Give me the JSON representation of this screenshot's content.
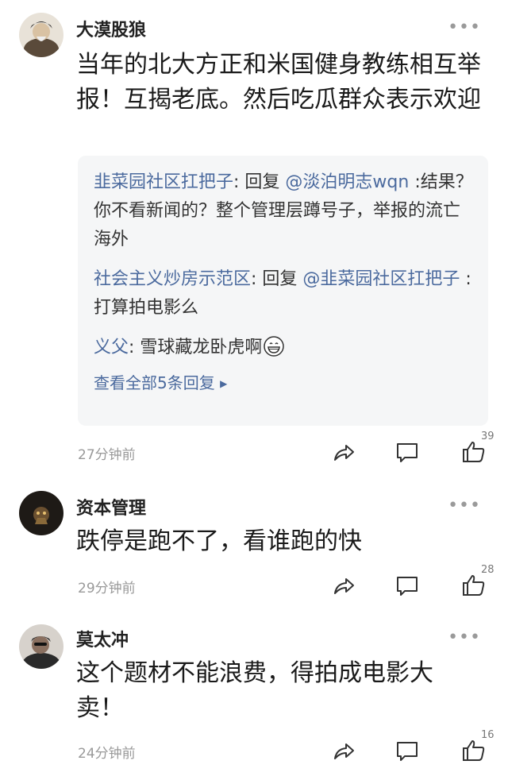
{
  "comments": [
    {
      "username": "大漠股狼",
      "more": "•••",
      "content": "当年的北大方正和米国健身教练相互举报！互揭老底。然后吃瓜群众表示欢迎",
      "replies": [
        {
          "name": "韭菜园社区扛把子",
          "sep": ": 回复 ",
          "at": "@淡泊明志wqn",
          "text": " :结果？你不看新闻的？整个管理层蹲号子，举报的流亡海外"
        },
        {
          "name": "社会主义炒房示范区",
          "sep": ": 回复 ",
          "at": "@韭菜园社区扛把子",
          "text": " :打算拍电影么"
        },
        {
          "name": "义父",
          "sep": ": ",
          "at": "",
          "text": "雪球藏龙卧虎啊"
        }
      ],
      "view_all": "查看全部5条回复",
      "time": "27分钟前",
      "likes": "39"
    },
    {
      "username": "资本管理",
      "more": "•••",
      "content": "跌停是跑不了，看谁跑的快",
      "time": "29分钟前",
      "likes": "28"
    },
    {
      "username": "莫太冲",
      "more": "•••",
      "content": "这个题材不能浪费，得拍成电影大卖！",
      "time": "24分钟前",
      "likes": "16"
    }
  ],
  "icons": {
    "share": "share-icon",
    "comment": "comment-icon",
    "like": "thumbs-up-icon",
    "more": "more-icon",
    "emoji": "grin-emoji-icon"
  },
  "colors": {
    "link": "#4b6a9e",
    "reply_bg": "#f5f6f7",
    "meta_gray": "#999999"
  }
}
